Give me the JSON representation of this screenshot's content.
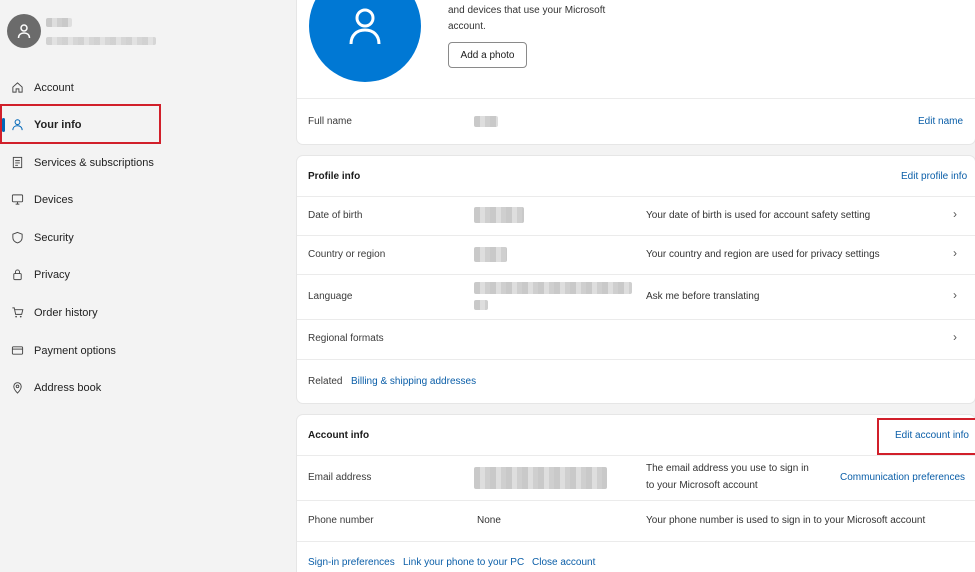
{
  "sidebar": {
    "items": [
      {
        "label": "Account",
        "icon": "home-icon"
      },
      {
        "label": "Your info",
        "icon": "person-icon",
        "active": true
      },
      {
        "label": "Services & subscriptions",
        "icon": "receipt-icon"
      },
      {
        "label": "Devices",
        "icon": "monitor-icon"
      },
      {
        "label": "Security",
        "icon": "shield-icon"
      },
      {
        "label": "Privacy",
        "icon": "lock-icon"
      },
      {
        "label": "Order history",
        "icon": "cart-icon"
      },
      {
        "label": "Payment options",
        "icon": "card-icon"
      },
      {
        "label": "Address book",
        "icon": "location-pin-icon"
      }
    ]
  },
  "photo_card": {
    "description_line1": "and devices that use your Microsoft",
    "description_line2": "account.",
    "add_photo_label": "Add a photo",
    "full_name_label": "Full name",
    "edit_name_label": "Edit name"
  },
  "profile_info": {
    "title": "Profile info",
    "edit_label": "Edit profile info",
    "rows": [
      {
        "label": "Date of birth",
        "note": "Your date of birth is used for account safety setting"
      },
      {
        "label": "Country or region",
        "note": "Your country and region are used for privacy settings"
      },
      {
        "label": "Language",
        "note": "Ask me before translating"
      },
      {
        "label": "Regional formats",
        "note": ""
      }
    ],
    "related_label": "Related",
    "related_link": "Billing & shipping addresses"
  },
  "account_info": {
    "title": "Account info",
    "edit_label": "Edit account info",
    "email_label": "Email address",
    "email_note_line1": "The email address you use to sign in",
    "email_note_line2": "to your Microsoft account",
    "communication_link": "Communication preferences",
    "phone_label": "Phone number",
    "phone_value": "None",
    "phone_note": "Your phone number is used to sign in to your Microsoft account",
    "footer_links": [
      "Sign-in preferences",
      "Link your phone to your PC",
      "Close account"
    ]
  },
  "colors": {
    "accent": "#0067b8",
    "highlight": "#d11f2a",
    "link": "#0a5ea8"
  }
}
